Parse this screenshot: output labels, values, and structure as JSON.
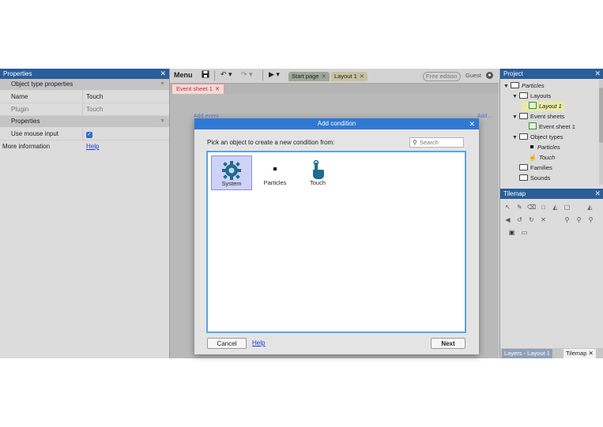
{
  "properties": {
    "title": "Properties",
    "section1": "Object type properties",
    "rows1": [
      {
        "key": "Name",
        "value": "Touch"
      },
      {
        "key": "Plugin",
        "value": "Touch"
      }
    ],
    "section2": "Properties",
    "mouse_input_label": "Use mouse input",
    "mouse_input_checked": true,
    "more_info_label": "More information",
    "more_info_link": "Help"
  },
  "toolbar": {
    "menu": "Menu",
    "tabs": [
      {
        "label": "Start page"
      },
      {
        "label": "Layout 1"
      }
    ],
    "free_edition": "Free edition",
    "guest": "Guest"
  },
  "editor": {
    "sheet_tab": "Event sheet 1",
    "ghost_left": "Add event",
    "ghost_right": "Add..."
  },
  "dialog": {
    "title": "Add condition",
    "prompt": "Pick an object to create a new condition from:",
    "search_placeholder": "Search",
    "objects": [
      {
        "label": "System",
        "icon": "gear-icon",
        "selected": true
      },
      {
        "label": "Particles",
        "icon": "particles-icon",
        "selected": false
      },
      {
        "label": "Touch",
        "icon": "touch-icon",
        "selected": false
      }
    ],
    "cancel": "Cancel",
    "help": "Help",
    "next": "Next"
  },
  "project": {
    "title": "Project",
    "root": "Particles",
    "layouts": "Layouts",
    "layout1": "Layout 1",
    "event_sheets": "Event sheets",
    "event_sheet1": "Event sheet 1",
    "object_types": "Object types",
    "obj_particles": "Particles",
    "obj_touch": "Touch",
    "families": "Families",
    "sounds": "Sounds"
  },
  "tilemap": {
    "title": "Tilemap",
    "bottom_tabs": [
      "Layers - Layout 1",
      "Tilemap"
    ]
  },
  "colors": {
    "panel_header": "#2a5d9a",
    "dialog_header": "#2f78d4",
    "selection": "#cfd2f7",
    "touch_icon": "#1f6c8c"
  }
}
